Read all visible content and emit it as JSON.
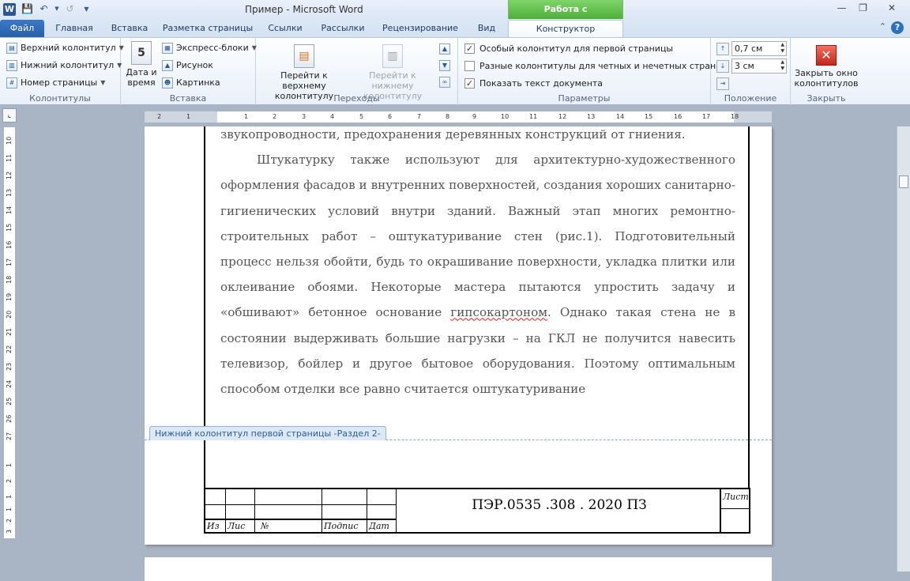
{
  "window": {
    "app_icon": "W",
    "title": "Пример  -  Microsoft Word",
    "context_tab_title": "Работа с колонтитулами",
    "qat_icons": [
      "save-icon",
      "undo-icon",
      "redo-icon",
      "customize-icon"
    ],
    "controls": [
      "minimize-icon",
      "maximize-icon",
      "close-icon"
    ]
  },
  "tabs": {
    "file": "Файл",
    "home": "Главная",
    "insert": "Вставка",
    "layout": "Разметка страницы",
    "references": "Ссылки",
    "mailings": "Рассылки",
    "review": "Рецензирование",
    "view": "Вид",
    "design": "Конструктор",
    "help": "?"
  },
  "ribbon": {
    "headers_footers": {
      "header": "Верхний колонтитул",
      "footer": "Нижний колонтитул",
      "page_number": "Номер страницы",
      "label": "Колонтитулы"
    },
    "insert": {
      "date_time_line1": "Дата и",
      "date_time_line2": "время",
      "quick_parts": "Экспресс-блоки",
      "picture": "Рисунок",
      "clip_art": "Картинка",
      "label": "Вставка"
    },
    "navigation": {
      "goto_header_line1": "Перейти к верхнему",
      "goto_header_line2": "колонтитулу",
      "goto_footer_line1": "Перейти к нижнему",
      "goto_footer_line2": "колонтитулу",
      "label": "Переходы"
    },
    "options": {
      "different_first": "Особый колонтитул для первой страницы",
      "different_odd_even": "Разные колонтитулы для четных и нечетных страниц",
      "show_document_text": "Показать текст документа",
      "different_first_checked": true,
      "different_odd_even_checked": false,
      "show_document_text_checked": true,
      "label": "Параметры"
    },
    "position": {
      "header_from_top": "0,7 см",
      "footer_from_bottom": "3 см",
      "label": "Положение"
    },
    "close": {
      "close_line1": "Закрыть окно",
      "close_line2": "колонтитулов",
      "label": "Закрыть"
    }
  },
  "ruler": {
    "h_ticks": [
      "2",
      "1",
      "1",
      "2",
      "3",
      "4",
      "5",
      "6",
      "7",
      "8",
      "9",
      "10",
      "11",
      "12",
      "13",
      "14",
      "15",
      "16",
      "17",
      "18"
    ],
    "v_ticks": [
      "10",
      "11",
      "12",
      "13",
      "14",
      "15",
      "16",
      "17",
      "18",
      "19",
      "20",
      "21",
      "22",
      "23",
      "24",
      "25",
      "26",
      "27"
    ],
    "v_ticks_bottom": [
      "1",
      "2",
      "1",
      "1",
      "2",
      "3"
    ]
  },
  "document": {
    "first_line": "звукопроводности, предохранения деревянных конструкций от гниения.",
    "para_before": "Штукатурку также используют для архитектурно-художественного оформления фасадов и внутренних поверхностей, создания хороших санитарно-гигиенических условий внутри зданий. Важный этап многих ремонтно-строительных работ – оштукатуривание стен (рис.1). Подготовительный процесс нельзя обойти, будь то окрашивание поверхности, укладка плитки или оклеивание обоями. Некоторые мастера пытаются упростить задачу и «обшивают» бетонное основание",
    "para_misspelled": "гипсокартоном",
    "para_after": ". Однако такая стена не в состоянии выдерживать большие нагрузки – на ГКЛ не получится навесить телевизор, бойлер и другое бытовое оборудования. Поэтому оптимальным способом отделки все равно считается оштукатуривание",
    "footer_tag": "Нижний колонтитул первой страницы -Раздел 2-"
  },
  "stamp": {
    "headers": [
      "Из",
      "Лис",
      "№",
      "Подпис",
      "Дат"
    ],
    "document_code": "ПЭР.0535 .308 . 2020  ПЗ",
    "sheet_label": "Лист"
  }
}
